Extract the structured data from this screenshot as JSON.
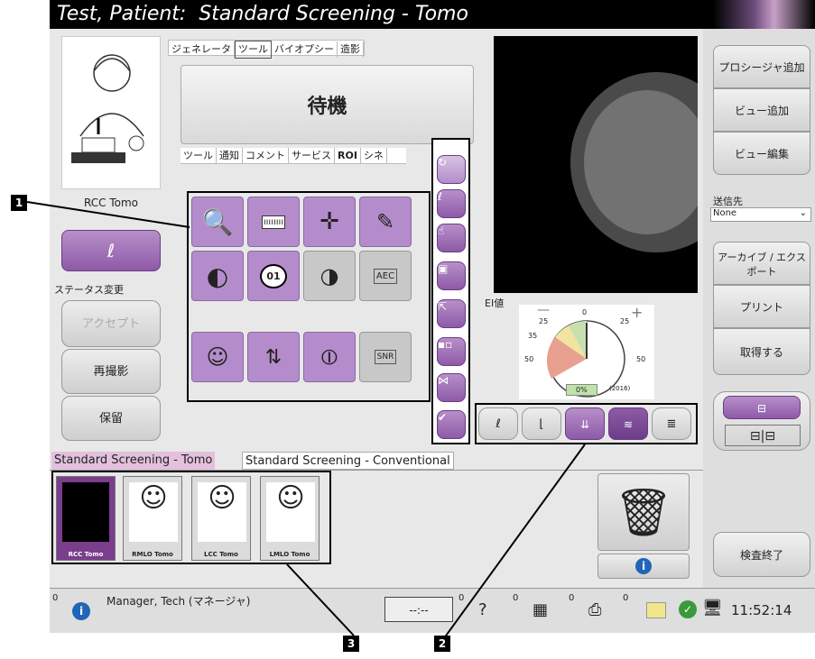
{
  "title": "Test, Patient:  Standard Screening - Tomo",
  "tabs_top": [
    "ジェネレータ",
    "ツール",
    "バイオプシー",
    "造影"
  ],
  "status_box": "待機",
  "tool_tabs": [
    "ツール",
    "通知",
    "コメント",
    "サービス",
    "ROI",
    "シネ"
  ],
  "view_label": "RCC Tomo",
  "status_change": "ステータス変更",
  "accept_label": "アクセプト",
  "retake_label": "再撮影",
  "hold_label": "保留",
  "ei_label": "EI値",
  "gauge": {
    "ticks": [
      "0",
      "25",
      "25",
      "35",
      "50",
      "50"
    ],
    "percent": "0%",
    "year": "(2016)",
    "value": 0
  },
  "right_buttons": {
    "add_procedure": "プロシージャ追加",
    "add_view": "ビュー追加",
    "edit_view": "ビュー編集",
    "send_to": "送信先",
    "send_value": "None",
    "archive": "アーカイブ / エクスポート",
    "print": "プリント",
    "acquire": "取得する",
    "end_exam": "検査終了"
  },
  "procedure_tabs": [
    "Standard Screening - Tomo",
    "Standard Screening - Conventional"
  ],
  "thumbnails": [
    "RCC Tomo",
    "RMLO Tomo",
    "LCC Tomo",
    "LMLO Tomo"
  ],
  "tool_text": {
    "aec": "AEC",
    "ruler": "ıııııııı",
    "window": "01",
    "snr": "SNR"
  },
  "statusbar": {
    "user": "Manager, Tech (マネージャ)",
    "time": "11:52:14",
    "count0": "0",
    "counts": [
      "0",
      "0",
      "0",
      "0",
      "0"
    ],
    "clock_display": "--:--"
  },
  "callouts": [
    "1",
    "2",
    "3"
  ],
  "colors": {
    "accent": "#9b6bb5",
    "titlebar": "#000000"
  }
}
